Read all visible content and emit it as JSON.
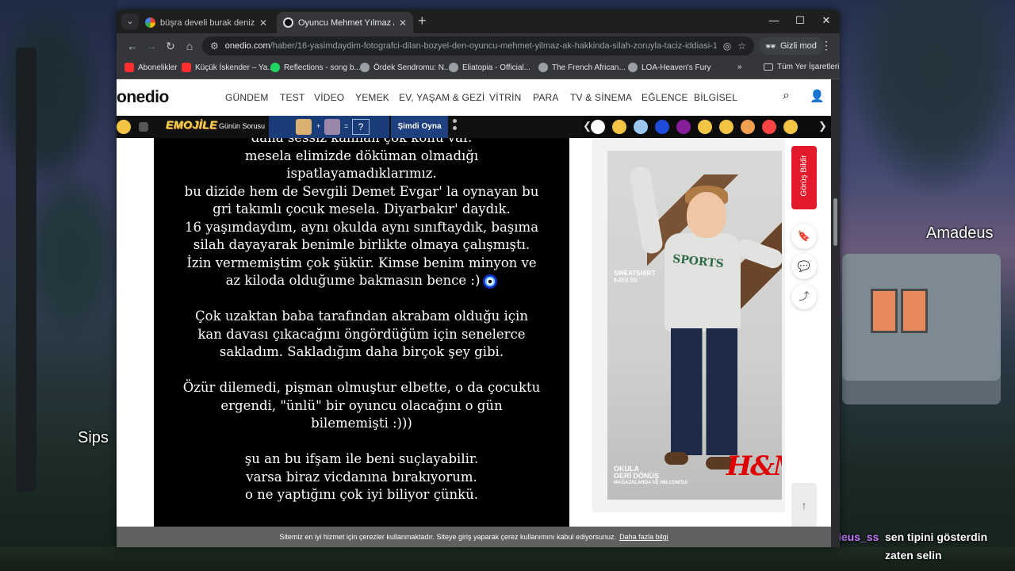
{
  "overlay": {
    "left_name": "Sips",
    "right_name": "Amadeus",
    "chat": [
      {
        "user": "Amadeus_ss",
        "message_line1": "sen tipini gösterdin",
        "message_line2": "zaten selin"
      }
    ]
  },
  "browser": {
    "tabs": [
      {
        "title": "büşra develi burak deniz - Goo...",
        "favicon": "google-icon",
        "active": false
      },
      {
        "title": "Oyuncu Mehmet Yılmaz Ak Hak...",
        "favicon": "onedio-icon",
        "active": true
      }
    ],
    "url_domain": "onedio.com",
    "url_path": "/haber/16-yasimdaydim-fotografci-dilan-bozyel-den-oyuncu-mehmet-yilmaz-ak-hakkinda-silah-zoruyla-taciz-iddiasi-1...",
    "incognito_label": "Gizli mod",
    "bookmarks": [
      {
        "label": "Abonelikler",
        "color": "#ff2d2d"
      },
      {
        "label": "Küçük İskender – Ya...",
        "color": "#ff2d2d"
      },
      {
        "label": "Reflections - song b...",
        "color": "#1ed760"
      },
      {
        "label": "Ördek Sendromu: N...",
        "color": "#9aa0a6"
      },
      {
        "label": "Eliatopia - Official...",
        "color": "#9aa0a6"
      },
      {
        "label": "The French African...",
        "color": "#9aa0a6"
      },
      {
        "label": "LOA-Heaven's Fury",
        "color": "#9aa0a6"
      }
    ],
    "bookmarks_more": "»",
    "all_bookmarks": "Tüm Yer İşaretleri"
  },
  "site": {
    "logo": "onedio",
    "nav": [
      "GÜNDEM",
      "TEST",
      "VİDEO",
      "YEMEK",
      "EV, YAŞAM & GEZİ",
      "VİTRİN",
      "PARA",
      "TV & SİNEMA",
      "EĞLENCE",
      "BİLGİSEL"
    ],
    "emojile": {
      "brand": "EMOJİLE",
      "subtitle": "Günün Sorusu",
      "plus": "+",
      "equals": "=",
      "question": "?",
      "play": "Şimdi Oyna"
    },
    "emoji_colors": [
      "#ffffff",
      "#f4c542",
      "#1e90ff",
      "#1e4bd8",
      "#8a1c9e",
      "#f4c542",
      "#f4c542",
      "#f0a050",
      "#ff4444",
      "#f4c542"
    ]
  },
  "article": {
    "lines": [
      "daha sessiz kalınan çok konu var.",
      "mesela elimizde döküman olmadığı",
      "ispatlayamadıklarımız.",
      "bu dizide hem de Sevgili Demet Evgar' la oynayan bu",
      "gri takımlı çocuk mesela. Diyarbakır' daydık.",
      "16 yaşımdaydım, aynı okulda aynı sınıftaydık, başıma",
      "silah dayayarak benimle birlikte olmaya çalışmıştı.",
      "İzin vermemiştim çok şükür. Kimse benim minyon ve",
      "az kiloda olduğume bakmasın bence :)",
      "",
      "Çok uzaktan baba tarafından akrabam olduğu için",
      "kan davası çıkacağını öngördüğüm için senelerce",
      "sakladım. Sakladığım daha birçok şey gibi.",
      "",
      "Özür dilemedi, pişman olmuştur elbette, o da çocuktu",
      "ergendi, \"ünlü\" bir oyuncu olacağını o gün",
      "bilememişti :)))",
      "",
      "şu an bu ifşam ile beni suçlayabilir.",
      "varsa biraz vicdanına bırakıyorum.",
      "o ne yaptığını çok iyi biliyor çünkü."
    ]
  },
  "ad": {
    "product": "SWEATSHIRT",
    "price": "₺459,99",
    "sweat_print": "SPORTS",
    "headline_1": "OKULA",
    "headline_2": "GERİ DÖNÜŞ",
    "footer": "MAĞAZALARDA VE HM.COM'DA",
    "brand": "H&M"
  },
  "side": {
    "feedback": "Görüş Bildir"
  },
  "cookie": {
    "text": "Sitemiz en iyi hizmet için çerezler kullanmaktadır. Siteye giriş yaparak çerez kullanımını kabul ediyorsunuz.",
    "link": "Daha fazla bilgi"
  }
}
